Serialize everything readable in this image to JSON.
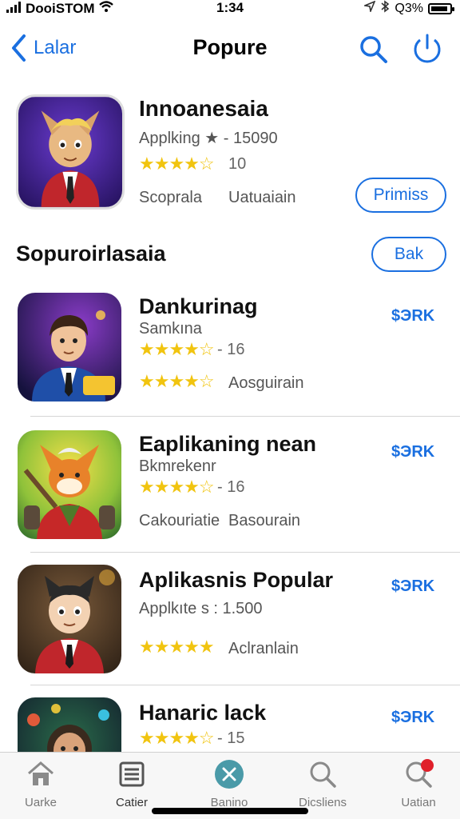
{
  "status": {
    "carrier": "DooiSTOM",
    "time": "1:34",
    "battery_text": "Q3%"
  },
  "nav": {
    "back_label": "Lalar",
    "title": "Popure"
  },
  "featured": {
    "title": "Innoanesaia",
    "subtitle": "Applking ★ - 15090",
    "stars": "★★★★☆",
    "rating_count": "10",
    "meta1": "Scoprala",
    "meta2": "Uatuaiain",
    "button_label": "Primiss"
  },
  "section": {
    "title": "Sopuroirlasaia",
    "button_label": "Bak"
  },
  "apps": [
    {
      "title": "Dankurinag",
      "subtitle": "Samkına",
      "stars": "★★★★☆",
      "rating": "- 16",
      "meta1": "",
      "meta2": "Aosguirain",
      "stars2": "★★★★☆",
      "price": "$ЭRK"
    },
    {
      "title": "Eaplikaning nean",
      "subtitle": "Bkmrekenr",
      "stars": "★★★★☆",
      "rating": "- 16",
      "meta1": "Cakouriatie",
      "meta2": "Basourain",
      "price": "$ЭRK"
    },
    {
      "title": "Aplikasnis Popular",
      "subtitle": "Applkıte s : 1.500",
      "stars": "★★★★★",
      "rating": "",
      "meta1": "",
      "meta2": "Aclranlain",
      "price": "$ЭRK"
    },
    {
      "title": "Hanaric lack",
      "subtitle": "",
      "stars": "★★★★☆",
      "rating": "- 15",
      "meta1": "",
      "meta2": "",
      "price": "$ЭRK"
    }
  ],
  "tabs": [
    {
      "label": "Uarke",
      "icon": "home-icon"
    },
    {
      "label": "Catier",
      "icon": "list-icon"
    },
    {
      "label": "Banino",
      "icon": "tools-icon"
    },
    {
      "label": "Dicsliens",
      "icon": "search-icon"
    },
    {
      "label": "Uatian",
      "icon": "search-badge-icon",
      "badge": "1"
    }
  ],
  "colors": {
    "accent": "#1a6fe0",
    "star": "#f1c40f",
    "badge": "#e0202a"
  }
}
